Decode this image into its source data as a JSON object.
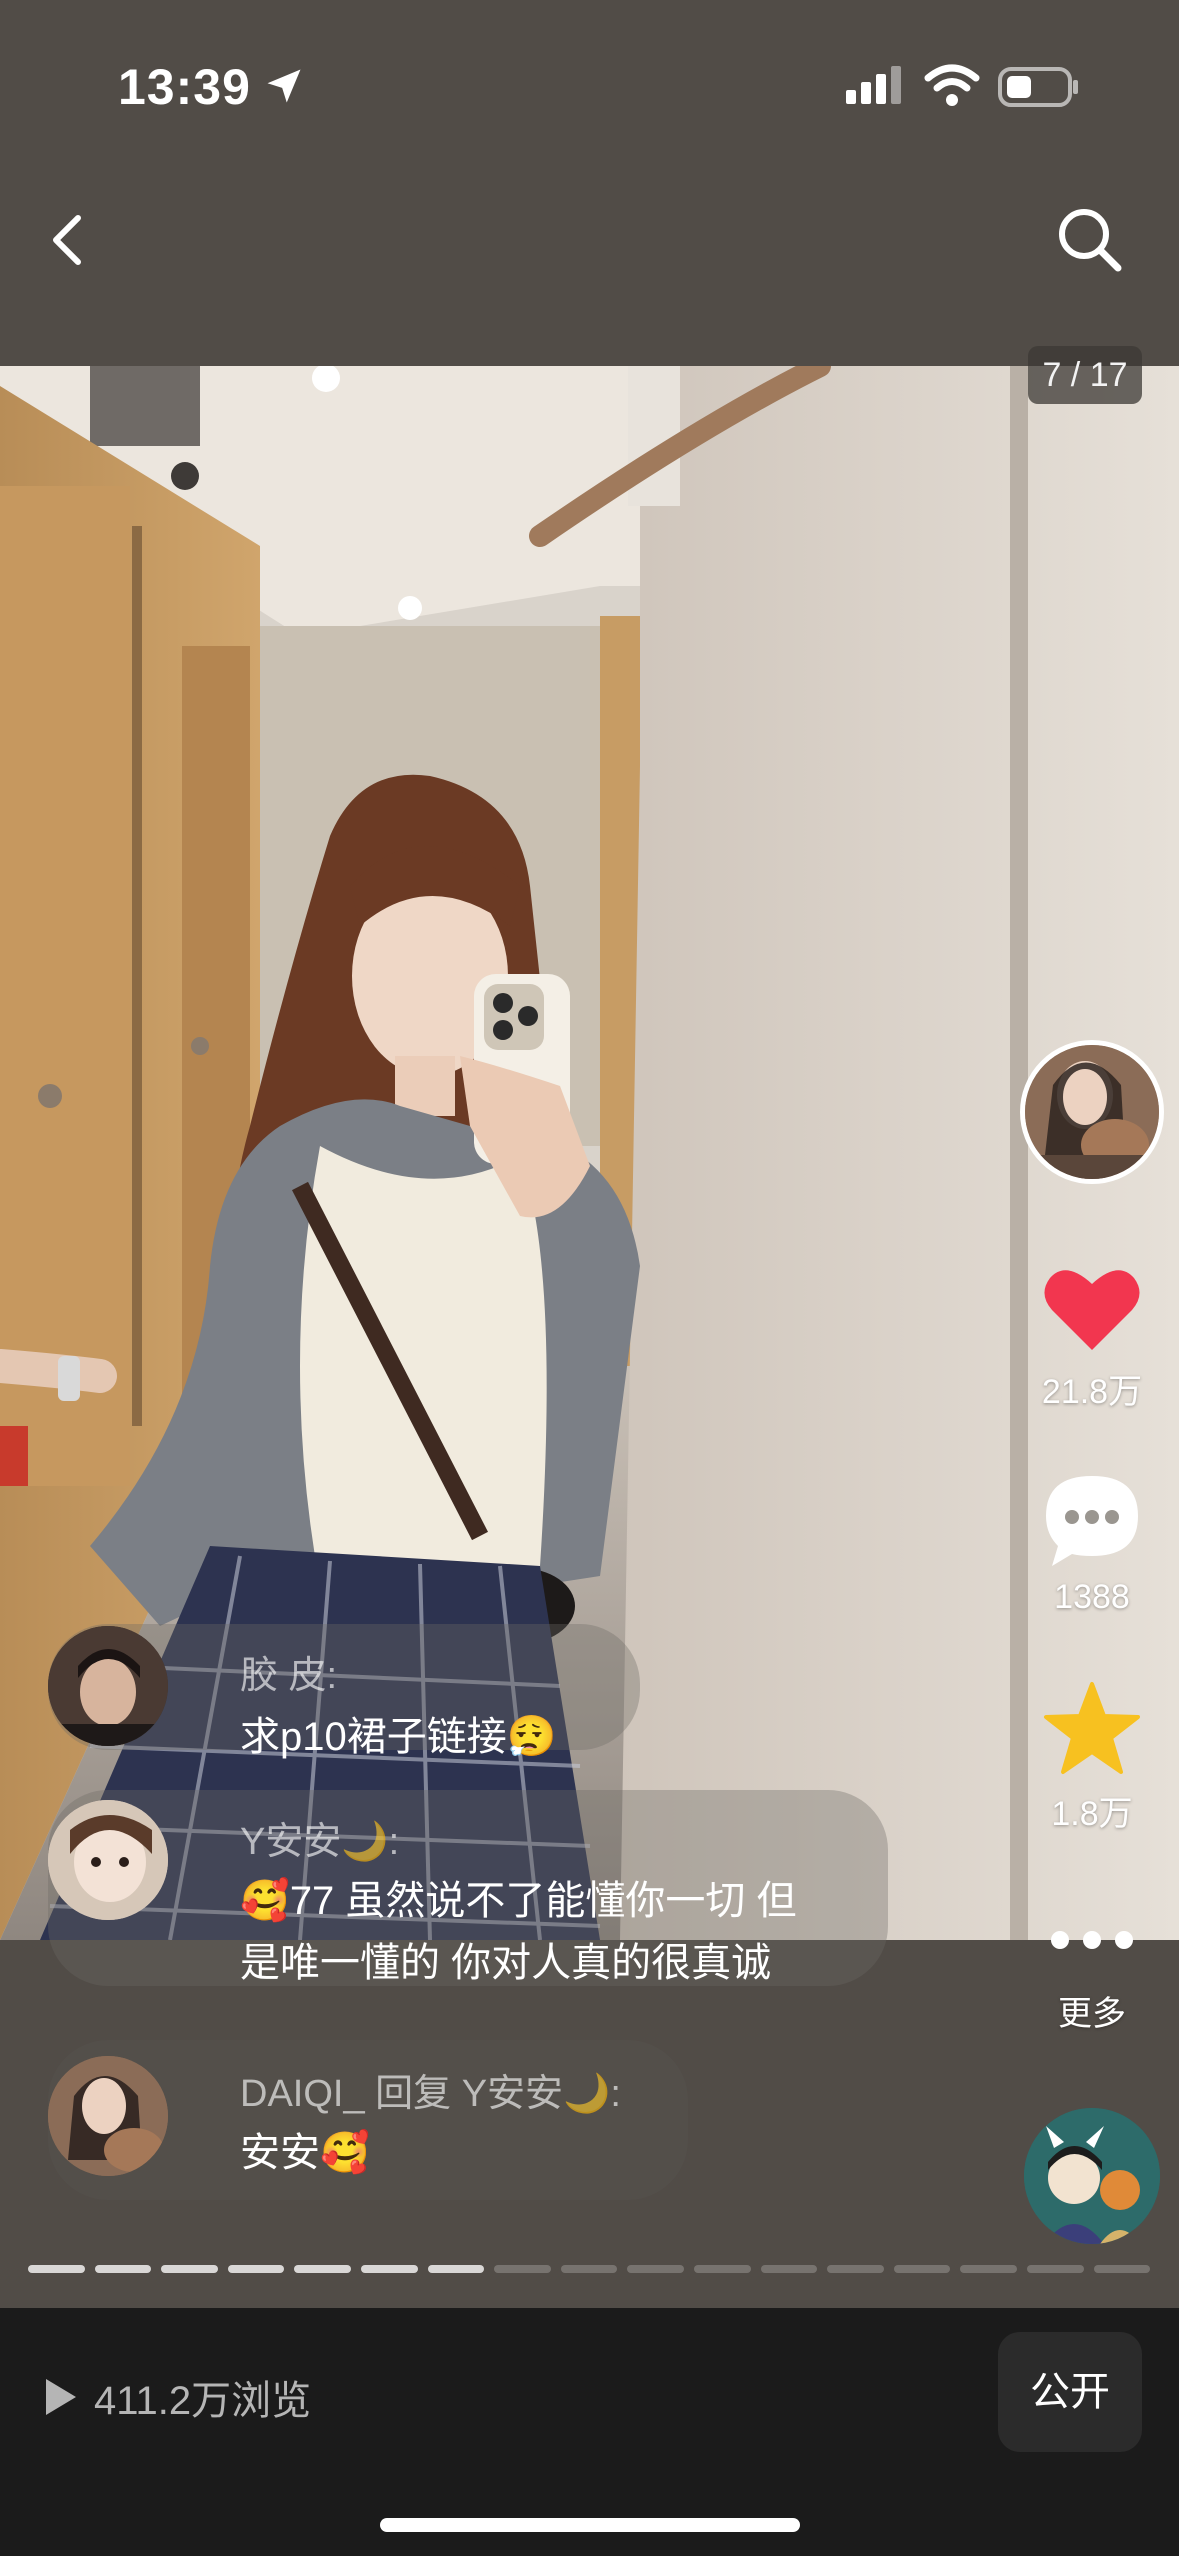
{
  "status_bar": {
    "time": "13:39"
  },
  "photo": {
    "page_counter": "7 / 17"
  },
  "actions": {
    "like_count": "21.8万",
    "comment_count": "1388",
    "favorite_count": "1.8万",
    "more_label": "更多"
  },
  "comments": [
    {
      "name": "胶 皮:",
      "text": "求p10裙子链接",
      "emoji": "😮‍💨"
    },
    {
      "name": "Y安安🌙:",
      "text_prefix_emoji": "🥰",
      "line1": "77 虽然说不了能懂你一切 但",
      "line2": "是唯一懂的 你对人真的很真诚"
    },
    {
      "name": "DAIQI_ 回复 Y安安🌙:",
      "text": "安安",
      "emoji": "🥰"
    }
  ],
  "progress": {
    "total": 17,
    "current": 7
  },
  "footer": {
    "views": "411.2万浏览",
    "public_label": "公开"
  },
  "colors": {
    "like_red": "#f2364f",
    "favorite_gold": "#f7c120",
    "bottom_bg": "#1b1b1b"
  }
}
